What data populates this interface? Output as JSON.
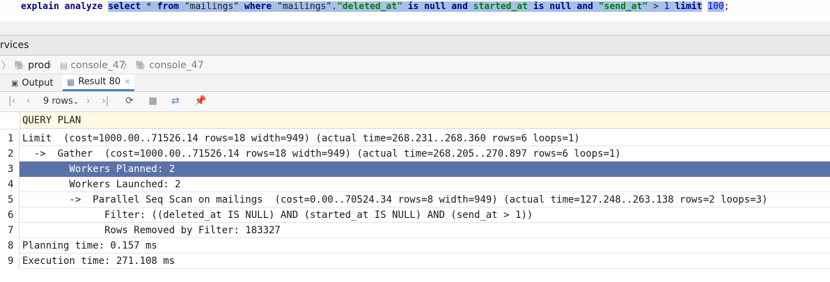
{
  "editor": {
    "line1": {
      "kw1": "explain analyze",
      "sel_select": "select",
      "sel_star": " * ",
      "sel_from": "from",
      "sel_table": " \"mailings\" ",
      "sel_where": "where",
      "sel_col": " \"mailings\".",
      "sel_deleted": "\"deleted_at\"",
      "sel_is1": " is ",
      "sel_null1": "null",
      "sel_and1": " and ",
      "sel_started": "started_at",
      "sel_is2": " is ",
      "sel_null2": "null",
      "sel_and2": " and ",
      "sel_send": "\"send_at\"",
      "sel_gt": " > ",
      "sel_one": "1",
      "limit_kw": "limit",
      "limit_val": "100",
      "semicolon": ";"
    }
  },
  "services": {
    "title": "rvices"
  },
  "breadcrumb": {
    "items": [
      "prod",
      "console_47",
      "console_47"
    ]
  },
  "tabs": [
    {
      "label": "Output"
    },
    {
      "label": "Result 80"
    }
  ],
  "toolbar": {
    "rows_label": "9 rows"
  },
  "grid": {
    "header": "QUERY PLAN",
    "rows": [
      {
        "n": "1",
        "text": "Limit  (cost=1000.00..71526.14 rows=18 width=949) (actual time=268.231..268.360 rows=6 loops=1)"
      },
      {
        "n": "2",
        "text": "  ->  Gather  (cost=1000.00..71526.14 rows=18 width=949) (actual time=268.205..270.897 rows=6 loops=1)"
      },
      {
        "n": "3",
        "text": "        Workers Planned: 2"
      },
      {
        "n": "4",
        "text": "        Workers Launched: 2"
      },
      {
        "n": "5",
        "text": "        ->  Parallel Seq Scan on mailings  (cost=0.00..70524.34 rows=8 width=949) (actual time=127.248..263.138 rows=2 loops=3)"
      },
      {
        "n": "6",
        "text": "              Filter: ((deleted_at IS NULL) AND (started_at IS NULL) AND (send_at > 1))"
      },
      {
        "n": "7",
        "text": "              Rows Removed by Filter: 183327"
      },
      {
        "n": "8",
        "text": "Planning time: 0.157 ms"
      },
      {
        "n": "9",
        "text": "Execution time: 271.108 ms"
      }
    ]
  },
  "colors": {
    "selection": "#5a72a8",
    "header_bg": "#fdf9e3",
    "tab_accent": "#4a83c9"
  }
}
